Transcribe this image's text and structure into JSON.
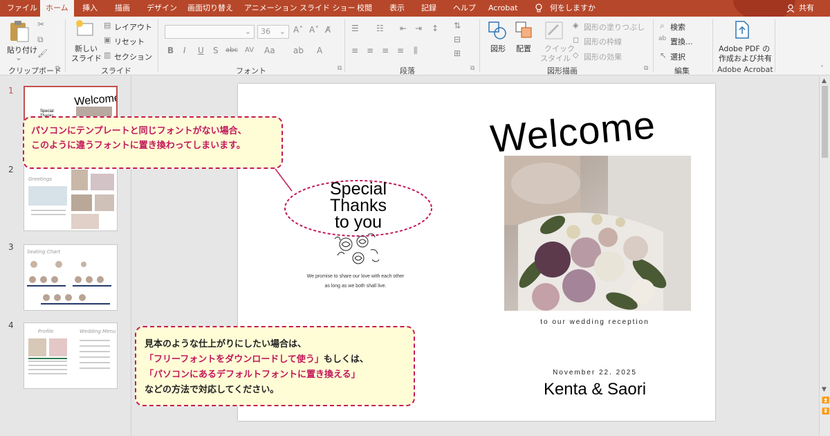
{
  "tabs": {
    "file": "ファイル",
    "home": "ホーム",
    "insert": "挿入",
    "draw": "描画",
    "design": "デザイン",
    "transitions": "画面切り替え",
    "animations": "アニメーション",
    "slideshow": "スライド ショー",
    "review": "校閲",
    "view": "表示",
    "record": "記録",
    "help": "ヘルプ",
    "acrobat": "Acrobat",
    "tell_me": "何をしますか",
    "share": "共有"
  },
  "ribbon": {
    "clipboard": {
      "paste": "貼り付け",
      "label": "クリップボード"
    },
    "slides": {
      "new_slide_1": "新しい",
      "new_slide_2": "スライド",
      "layout": "レイアウト",
      "reset": "リセット",
      "section": "セクション",
      "label": "スライド"
    },
    "font": {
      "font_size": "36",
      "label": "フォント"
    },
    "paragraph": {
      "label": "段落"
    },
    "drawing": {
      "shapes": "図形",
      "arrange": "配置",
      "quick_style_1": "クイック",
      "quick_style_2": "スタイル",
      "fill": "図形の塗りつぶし",
      "outline": "図形の枠線",
      "effects": "図形の効果",
      "label": "図形描画"
    },
    "editing": {
      "find": "検索",
      "replace": "置換...",
      "select": "選択",
      "label": "編集"
    },
    "acrobat": {
      "line1": "Adobe PDF の",
      "line2": "作成および共有",
      "label": "Adobe Acrobat"
    }
  },
  "slide_numbers": [
    "1",
    "2",
    "3",
    "4"
  ],
  "slide": {
    "welcome": "Welcome",
    "special_lines": [
      "Special",
      "Thanks",
      "to you"
    ],
    "promise_lines": [
      "We promise to share our love with each other",
      "as long as we both shall live."
    ],
    "reception": "to our wedding reception",
    "date": "November 22. 2025",
    "names": "Kenta & Saori"
  },
  "callout_top": {
    "line1": "パソコンにテンプレートと同じフォントがない場合、",
    "line2": "このように違うフォントに置き換わってしまいます。"
  },
  "callout_bottom": {
    "line1": "見本のような仕上がりにしたい場合は、",
    "line2": "「フリーフォントをダウンロードして使う」",
    "line2_tail": "もしくは、",
    "line3": "「パソコンにあるデフォルトフォントに置き換える」",
    "line4": "などの方法で対応してください。"
  },
  "colors": {
    "accent": "#b7472a",
    "callout_border": "#c2185b",
    "callout_fill": "#fffdd6",
    "selected_thumb": "#c0504d"
  }
}
